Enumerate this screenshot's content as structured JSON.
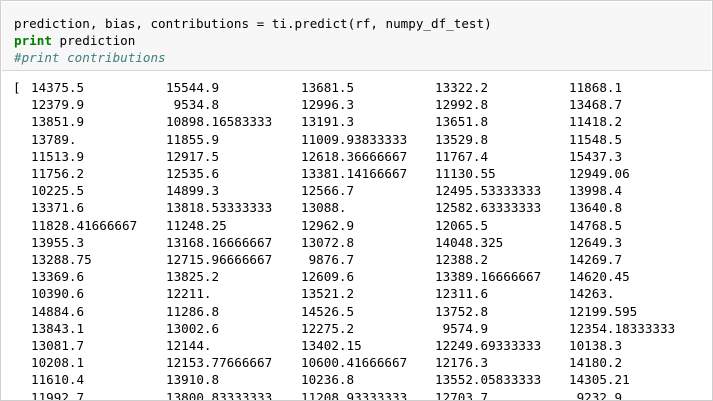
{
  "code": {
    "line1": "prediction, bias, contributions = ti.predict(rf, numpy_df_test)",
    "line2_keyword": "print",
    "line2_rest": " prediction",
    "line3_comment": "#print contributions"
  },
  "output": {
    "open_bracket": "[",
    "rows": [
      [
        "14375.5",
        "15544.9",
        "13681.5",
        "13322.2",
        "11868.1"
      ],
      [
        "12379.9",
        " 9534.8",
        "12996.3",
        "12992.8",
        "13468.7"
      ],
      [
        "13851.9",
        "10898.16583333",
        "13191.3",
        "13651.8",
        "11418.2"
      ],
      [
        "13789.",
        "11855.9",
        "11009.93833333",
        "13529.8",
        "11548.5"
      ],
      [
        "11513.9",
        "12917.5",
        "12618.36666667",
        "11767.4",
        "15437.3"
      ],
      [
        "11756.2",
        "12535.6",
        "13381.14166667",
        "11130.55",
        "12949.06"
      ],
      [
        "10225.5",
        "14899.3",
        "12566.7",
        "12495.53333333",
        "13998.4"
      ],
      [
        "13371.6",
        "13818.53333333",
        "13088.",
        "12582.63333333",
        "13640.8"
      ],
      [
        "11828.41666667",
        "11248.25",
        "12962.9",
        "12065.5",
        "14768.5"
      ],
      [
        "13955.3",
        "13168.16666667",
        "13072.8",
        "14048.325",
        "12649.3"
      ],
      [
        "13288.75",
        "12715.96666667",
        " 9876.7",
        "12388.2",
        "14269.7"
      ],
      [
        "13369.6",
        "13825.2",
        "12609.6",
        "13389.16666667",
        "14620.45"
      ],
      [
        "10390.6",
        "12211.",
        "13521.2",
        "12311.6",
        "14263."
      ],
      [
        "14884.6",
        "11286.8",
        "14526.5",
        "13752.8",
        "12199.595"
      ],
      [
        "13843.1",
        "13002.6",
        "12275.2",
        " 9574.9",
        "12354.18333333"
      ],
      [
        "13081.7",
        "12144.",
        "13402.15",
        "12249.69333333",
        "10138.3"
      ],
      [
        "10208.1",
        "12153.77666667",
        "10600.41666667",
        "12176.3",
        "14180.2"
      ],
      [
        "11610.4",
        "13910.8",
        "10236.8",
        "13552.05833333",
        "14305.21"
      ],
      [
        "11992.7",
        "13800.83333333",
        "11208.93333333",
        "12703.7",
        " 9232.9"
      ]
    ]
  }
}
